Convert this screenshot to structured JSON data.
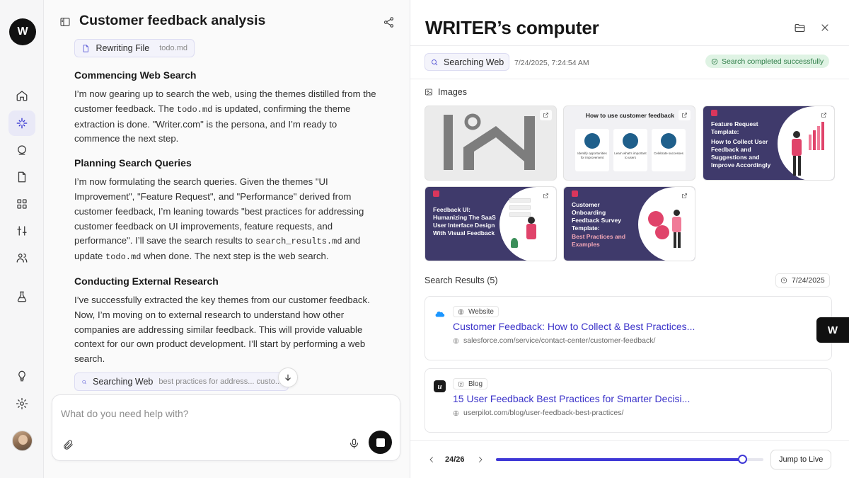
{
  "rail": {
    "logo": "W",
    "items": [
      "home",
      "agents",
      "chat",
      "docs",
      "apps",
      "tuning",
      "team",
      "lab"
    ],
    "bottom": [
      "ideas",
      "settings",
      "profile"
    ]
  },
  "chat": {
    "title": "Customer feedback analysis",
    "top_chip": {
      "label": "Rewriting File",
      "file": "todo.md"
    },
    "sections": [
      {
        "heading": "Commencing Web Search",
        "parts": [
          "I’m now gearing up to search the web, using the themes distilled from the customer feedback. The ",
          "todo.md",
          " is updated, confirming the theme extraction is done. \"Writer.com\" is the persona, and I’m ready to commence the next step."
        ]
      },
      {
        "heading": "Planning Search Queries",
        "parts": [
          "I’m now formulating the search queries. Given the themes \"UI Improvement\", \"Feature Request\", and \"Performance\" derived from customer feedback, I’m leaning towards \"best practices for addressing customer feedback on UI improvements, feature requests, and performance\". I’ll save the search results to ",
          "search_results.md",
          " and update ",
          "todo.md",
          " when done. The next step is the web search."
        ]
      },
      {
        "heading": "Conducting External Research",
        "parts": [
          "I’ve successfully extracted the key themes from our customer feedback. Now, I’m moving on to external research to understand how other companies are addressing similar feedback. This will provide valuable context for our own product development. I’ll start by performing a web search."
        ]
      }
    ],
    "bottom_chip": {
      "label": "Searching Web",
      "query": "best practices for address... custo..."
    },
    "composer_placeholder": "What do you need help with?"
  },
  "computer": {
    "title": "WRITER’s computer",
    "search_label": "Searching Web",
    "timestamp": "7/24/2025, 7:24:54 AM",
    "status": "Search completed successfully",
    "status_color": "#2e7d48",
    "images_label": "Images",
    "thumbnails": [
      {
        "title": "",
        "subtitle": ""
      },
      {
        "title": "How to use customer feedback",
        "steps": [
          "Identify opportunities for improvement",
          "Learn what's important to users",
          "Celebrate successes"
        ]
      },
      {
        "title": "Feature Request Template:",
        "subtitle": "How to Collect User Feedback and Suggestions and Improve Accordingly"
      },
      {
        "title": "Feedback UI: Humanizing The SaaS User Interface Design With Visual Feedback",
        "subtitle": ""
      },
      {
        "title": "Customer Onboarding Feedback Survey Template:",
        "subtitle": "Best Practices and Examples"
      }
    ],
    "results_label": "Search Results (5)",
    "results_date": "7/24/2025",
    "results": [
      {
        "type": "Website",
        "title": "Customer Feedback: How to Collect & Best Practices...",
        "url": "salesforce.com/service/contact-center/customer-feedback/",
        "favicon_color": "#1b96ff"
      },
      {
        "type": "Blog",
        "title": "15 User Feedback Best Practices for Smarter Decisi...",
        "url": "userpilot.com/blog/user-feedback-best-practices/",
        "favicon_color": "#1a1a1a",
        "favicon_glyph": "u"
      }
    ],
    "floating_logo": "W",
    "footer": {
      "page": "24/26",
      "progress": 0.92,
      "jump_label": "Jump to Live"
    },
    "accent": "#3f38d6"
  }
}
